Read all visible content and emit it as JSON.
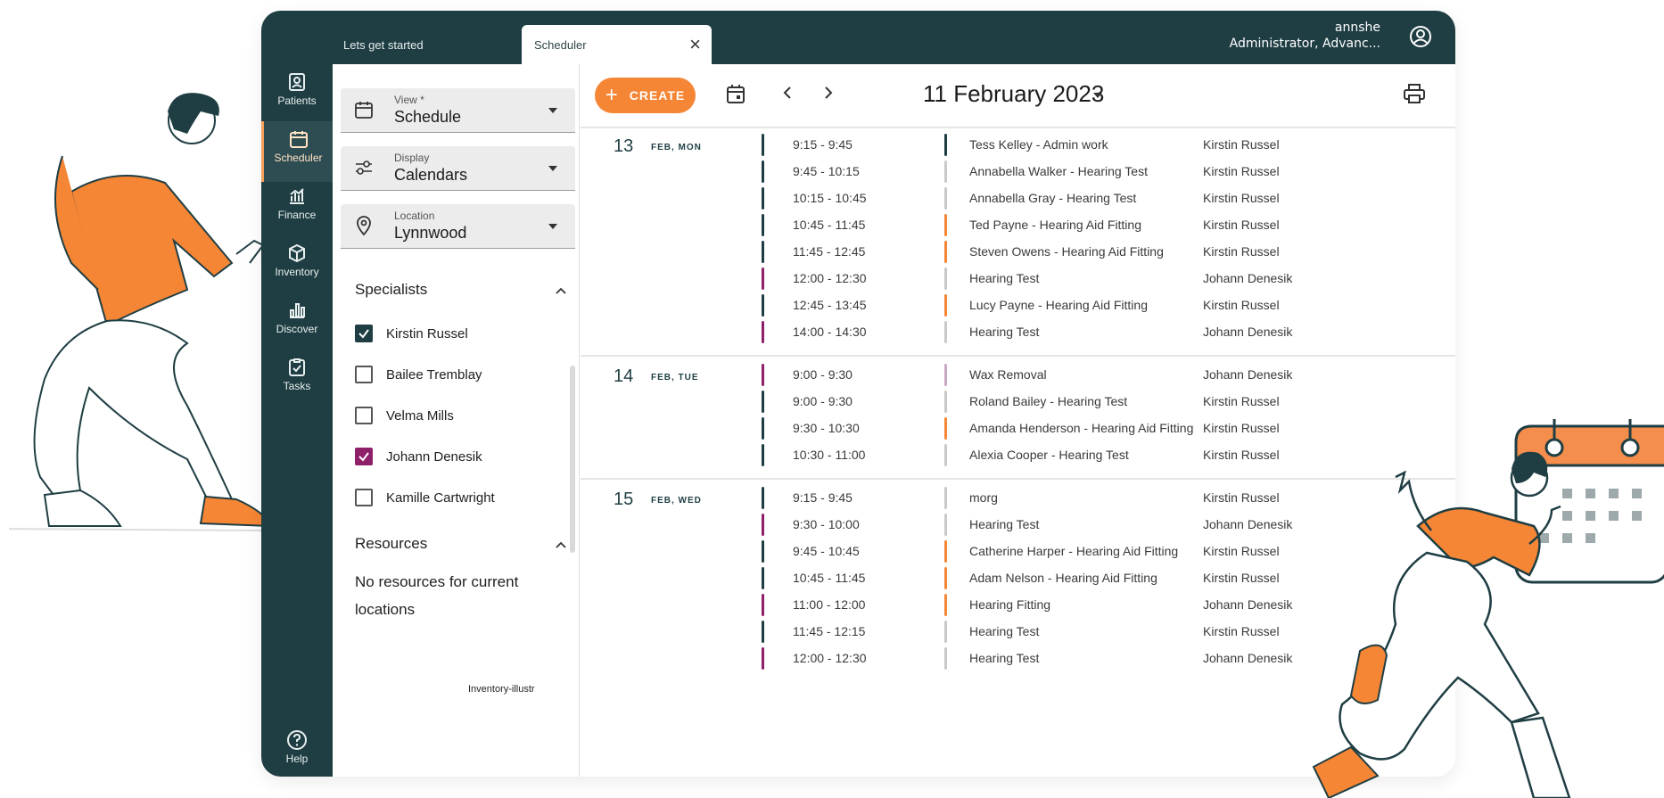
{
  "colors": {
    "primary": "#1f3e43",
    "accent": "#f58635",
    "purple": "#8e1f69",
    "gray": "#c9c9c9",
    "light_purple": "#c9a8c4"
  },
  "tabs": {
    "lets_get_started": "Lets get started",
    "scheduler": "Scheduler",
    "close": "×"
  },
  "user": {
    "name": "annshe",
    "role": "Administrator, Advanc..."
  },
  "nav": {
    "patients": "Patients",
    "scheduler": "Scheduler",
    "finance": "Finance",
    "inventory": "Inventory",
    "discover": "Discover",
    "tasks": "Tasks",
    "help": "Help"
  },
  "filters": {
    "view": {
      "label": "View *",
      "value": "Schedule"
    },
    "display": {
      "label": "Display",
      "value": "Calendars"
    },
    "location": {
      "label": "Location",
      "value": "Lynnwood"
    }
  },
  "specialists": {
    "title": "Specialists",
    "items": [
      {
        "name": "Kirstin Russel",
        "checked": true,
        "color": "#1f3e43"
      },
      {
        "name": "Bailee Tremblay",
        "checked": false
      },
      {
        "name": "Velma Mills",
        "checked": false
      },
      {
        "name": "Johann Denesik",
        "checked": true,
        "color": "#8e1f69"
      },
      {
        "name": "Kamille Cartwright",
        "checked": false
      }
    ]
  },
  "resources": {
    "title": "Resources",
    "empty": "No resources for current locations"
  },
  "image_alt": "Inventory-illustr",
  "header": {
    "create_label": "CREATE",
    "date": "11 February 2023"
  },
  "days": [
    {
      "num": "13",
      "label": "FEB, MON",
      "appointments": [
        {
          "time": "9:15 - 9:45",
          "title": "Tess Kelley - Admin work",
          "who": "Kirstin Russel",
          "bar": "#1f3e43",
          "tbar": "#1f3e43"
        },
        {
          "time": "9:45 - 10:15",
          "title": "Annabella Walker - Hearing Test",
          "who": "Kirstin Russel",
          "bar": "#1f3e43",
          "tbar": "#c9c9c9"
        },
        {
          "time": "10:15 - 10:45",
          "title": "Annabella Gray - Hearing Test",
          "who": "Kirstin Russel",
          "bar": "#1f3e43",
          "tbar": "#c9c9c9"
        },
        {
          "time": "10:45 - 11:45",
          "title": "Ted Payne - Hearing Aid Fitting",
          "who": "Kirstin Russel",
          "bar": "#1f3e43",
          "tbar": "#f58635"
        },
        {
          "time": "11:45 - 12:45",
          "title": "Steven Owens - Hearing Aid Fitting",
          "who": "Kirstin Russel",
          "bar": "#1f3e43",
          "tbar": "#f58635"
        },
        {
          "time": "12:00 - 12:30",
          "title": "Hearing Test",
          "who": "Johann Denesik",
          "bar": "#8e1f69",
          "tbar": "#c9c9c9"
        },
        {
          "time": "12:45 - 13:45",
          "title": "Lucy Payne - Hearing Aid Fitting",
          "who": "Kirstin Russel",
          "bar": "#1f3e43",
          "tbar": "#f58635"
        },
        {
          "time": "14:00 - 14:30",
          "title": "Hearing Test",
          "who": "Johann Denesik",
          "bar": "#8e1f69",
          "tbar": "#c9c9c9"
        }
      ]
    },
    {
      "num": "14",
      "label": "FEB, TUE",
      "appointments": [
        {
          "time": "9:00 - 9:30",
          "title": "Wax Removal",
          "who": "Johann Denesik",
          "bar": "#8e1f69",
          "tbar": "#c9a8c4"
        },
        {
          "time": "9:00 - 9:30",
          "title": "Roland Bailey - Hearing Test",
          "who": "Kirstin Russel",
          "bar": "#1f3e43",
          "tbar": "#c9c9c9"
        },
        {
          "time": "9:30 - 10:30",
          "title": "Amanda Henderson - Hearing Aid Fitting",
          "who": "Kirstin Russel",
          "bar": "#1f3e43",
          "tbar": "#f58635"
        },
        {
          "time": "10:30 - 11:00",
          "title": "Alexia Cooper - Hearing Test",
          "who": "Kirstin Russel",
          "bar": "#1f3e43",
          "tbar": "#c9c9c9"
        }
      ]
    },
    {
      "num": "15",
      "label": "FEB, WED",
      "appointments": [
        {
          "time": "9:15 - 9:45",
          "title": "morg",
          "who": "Kirstin Russel",
          "bar": "#1f3e43",
          "tbar": "#c9c9c9"
        },
        {
          "time": "9:30 - 10:00",
          "title": "Hearing Test",
          "who": "Johann Denesik",
          "bar": "#8e1f69",
          "tbar": "#c9c9c9"
        },
        {
          "time": "9:45 - 10:45",
          "title": "Catherine Harper - Hearing Aid Fitting",
          "who": "Kirstin Russel",
          "bar": "#1f3e43",
          "tbar": "#f58635"
        },
        {
          "time": "10:45 - 11:45",
          "title": "Adam Nelson - Hearing Aid Fitting",
          "who": "Kirstin Russel",
          "bar": "#1f3e43",
          "tbar": "#f58635"
        },
        {
          "time": "11:00 - 12:00",
          "title": "Hearing Fitting",
          "who": "Johann Denesik",
          "bar": "#8e1f69",
          "tbar": "#f58635"
        },
        {
          "time": "11:45 - 12:15",
          "title": "Hearing Test",
          "who": "Kirstin Russel",
          "bar": "#1f3e43",
          "tbar": "#c9c9c9"
        },
        {
          "time": "12:00 - 12:30",
          "title": "Hearing Test",
          "who": "Johann Denesik",
          "bar": "#8e1f69",
          "tbar": "#c9c9c9"
        }
      ]
    }
  ]
}
